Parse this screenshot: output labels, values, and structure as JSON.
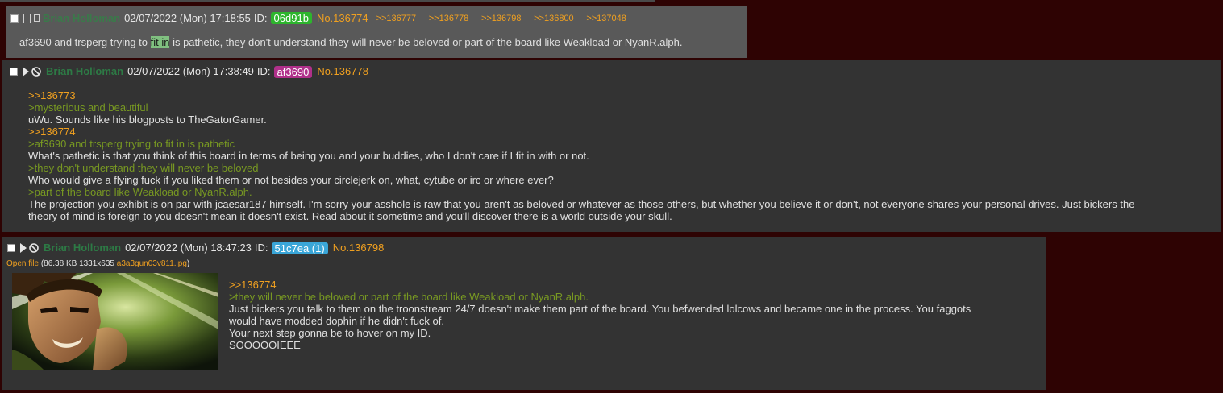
{
  "post1": {
    "name": "Brian Holloman",
    "date": "02/07/2022 (Mon) 17:18:55",
    "id_label": "ID:",
    "id": "06d91b",
    "id_color": "#2db52d",
    "post_no": "No.136774",
    "backlinks": [
      ">>136777",
      ">>136778",
      ">>136798",
      ">>136800",
      ">>137048"
    ],
    "body_before": "af3690 and trsperg trying to ",
    "body_highlight": "fit in",
    "body_after": " is pathetic, they don't understand they will never be beloved or part of the board like Weakload or NyanR.alph."
  },
  "post2": {
    "name": "Brian Holloman",
    "date": "02/07/2022 (Mon) 17:38:49",
    "id_label": "ID:",
    "id": "af3690",
    "id_color": "#b0308a",
    "post_no": "No.136778",
    "lines": [
      {
        "type": "quotelink",
        "text": ">>136773"
      },
      {
        "type": "greentext",
        "text": ">mysterious and beautiful"
      },
      {
        "type": "text",
        "text": "uWu. Sounds like his blogposts to TheGatorGamer."
      },
      {
        "type": "quotelink",
        "text": ">>136774"
      },
      {
        "type": "greentext",
        "text": ">af3690 and trsperg trying to fit in is pathetic"
      },
      {
        "type": "text",
        "text": "What's pathetic is that you think of this board in terms of being you and your buddies, who I don't care if I fit in with or not."
      },
      {
        "type": "greentext",
        "text": ">they don't understand they will never be beloved"
      },
      {
        "type": "text",
        "text": "Who would give a flying fuck if you liked them or not besides your circlejerk on, what, cytube or irc or where ever?"
      },
      {
        "type": "greentext",
        "text": ">part of the board like Weakload or NyanR.alph."
      },
      {
        "type": "text",
        "text": "The projection you exhibit is on par with jcaesar187 himself. I'm sorry your asshole is raw that you aren't as beloved or whatever as those others, but whether you believe it or don't, not everyone shares your personal drives. Just bickers the"
      },
      {
        "type": "text",
        "text": "theory of mind is foreign to you doesn't mean it doesn't exist. Read about it sometime and you'll discover there is a world outside your skull."
      }
    ]
  },
  "post3": {
    "name": "Brian Holloman",
    "date": "02/07/2022 (Mon) 18:47:23",
    "id_label": "ID:",
    "id": "51c7ea (1)",
    "id_color": "#3aa6d8",
    "post_no": "No.136798",
    "file_open": "Open file",
    "file_meta": "(86.38 KB 1331x635",
    "file_name": "a3a3gun03v811.jpg",
    "file_close": ")",
    "lines": [
      {
        "type": "quotelink",
        "text": ">>136774"
      },
      {
        "type": "greentext",
        "text": ">they will never be beloved or part of the board like Weakload or NyanR.alph."
      },
      {
        "type": "text",
        "text": "Just bickers you talk to them on the troonstream 24/7 doesn't make them part of the board. You befwended lolcows and became one in the process. You faggots"
      },
      {
        "type": "text",
        "text": "would have modded dophin if he didn't fuck of."
      },
      {
        "type": "text",
        "text": "Your next step gonna be to hover on my ID."
      },
      {
        "type": "text",
        "text": "SOOOOOIEEE"
      }
    ]
  }
}
